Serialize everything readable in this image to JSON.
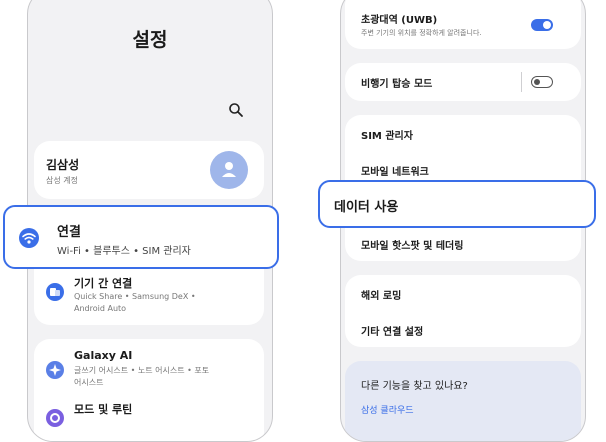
{
  "left": {
    "title": "설정",
    "account": {
      "name": "김삼성",
      "subtitle": "삼성 계정"
    },
    "connections": {
      "label": "연결",
      "subtitle": "Wi-Fi • 블루투스 • SIM 관리자"
    },
    "device_connect": {
      "label": "기기 간 연결",
      "subtitle_line1": "Quick Share • Samsung DeX •",
      "subtitle_line2": "Android Auto"
    },
    "galaxy_ai": {
      "label": "Galaxy AI",
      "subtitle_line1": "글쓰기 어시스트 • 노트 어시스트 • 포토",
      "subtitle_line2": "어시스트"
    },
    "modes": {
      "label": "모드 및 루틴"
    }
  },
  "right": {
    "uwb": {
      "label": "초광대역 (UWB)",
      "subtitle": "주변 기기의 위치를 정확하게 알려줍니다.",
      "enabled": true
    },
    "airplane": {
      "label": "비행기 탑승 모드",
      "enabled": false
    },
    "items": [
      "SIM 관리자",
      "모바일 네트워크",
      "데이터 사용",
      "모바일 핫스팟 및 테더링",
      "해외 로밍",
      "기타 연결 설정"
    ],
    "suggest": {
      "question": "다른 기능을 찾고 있나요?",
      "link": "삼성 클라우드"
    }
  },
  "colors": {
    "accent": "#3a6ee8",
    "background": "#f2f2f4",
    "link": "#3a6ee8"
  },
  "icons": [
    "search-icon",
    "person-icon",
    "wifi-icon",
    "device-connect-icon",
    "galaxy-ai-icon",
    "modes-routines-icon"
  ]
}
